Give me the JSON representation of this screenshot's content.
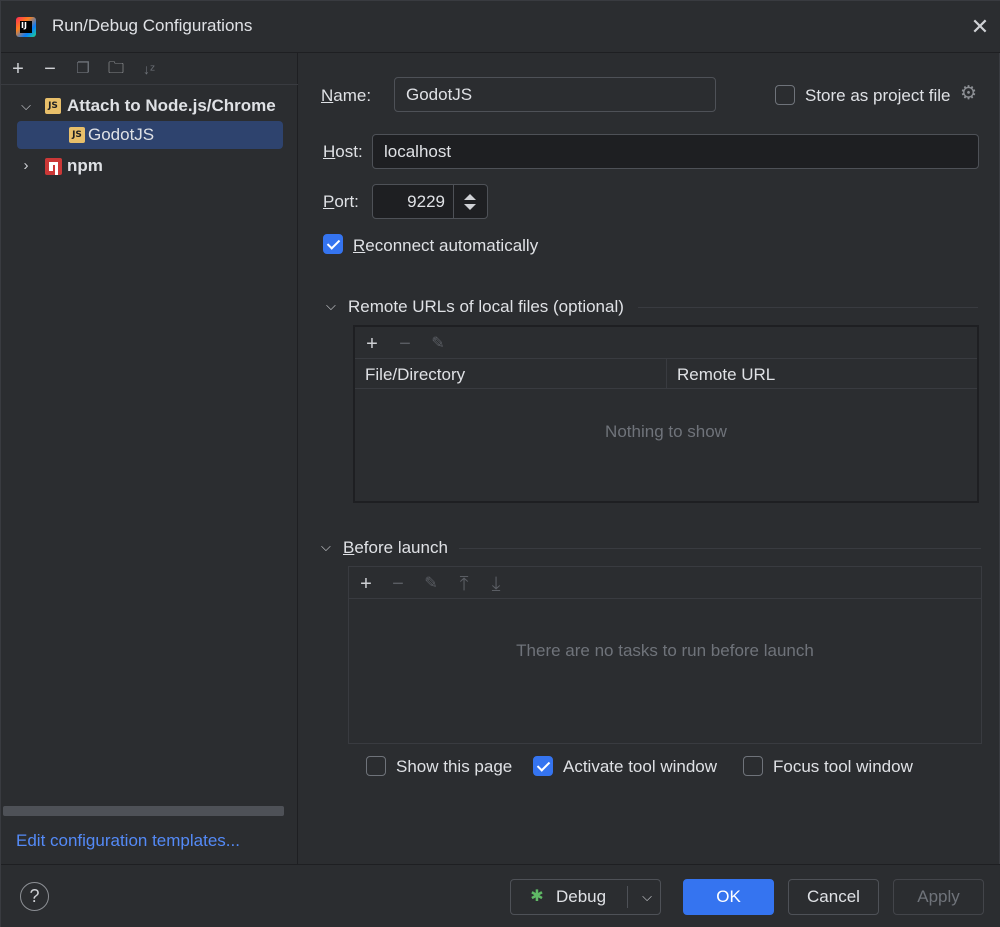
{
  "window": {
    "title": "Run/Debug Configurations"
  },
  "sidebar": {
    "tree": [
      {
        "label": "Attach to Node.js/Chrome",
        "icon": "js-icon",
        "icon_text": "JS",
        "expanded": true
      },
      {
        "label": "GodotJS",
        "icon": "js-icon",
        "icon_text": "JS",
        "selected": true
      },
      {
        "label": "npm",
        "icon": "npm-icon",
        "expanded": false
      }
    ],
    "templates_link": "Edit configuration templates..."
  },
  "form": {
    "name_label": "Name:",
    "name_value": "GodotJS",
    "store_label": "Store as project file",
    "store_checked": false,
    "host_label": "Host:",
    "host_value": "localhost",
    "port_label": "Port:",
    "port_value": "9229",
    "reconnect_label": "Reconnect automatically",
    "reconnect_checked": true
  },
  "remote_urls": {
    "section_title": "Remote URLs of local files (optional)",
    "columns": [
      "File/Directory",
      "Remote URL"
    ],
    "empty_text": "Nothing to show"
  },
  "before_launch": {
    "section_title": "Before launch",
    "empty_text": "There are no tasks to run before launch",
    "options": [
      {
        "label": "Show this page",
        "checked": false
      },
      {
        "label": "Activate tool window",
        "checked": true
      },
      {
        "label": "Focus tool window",
        "checked": false
      }
    ]
  },
  "footer": {
    "help": "?",
    "debug": "Debug",
    "ok": "OK",
    "cancel": "Cancel",
    "apply": "Apply"
  },
  "colors": {
    "accent": "#3574f0",
    "link": "#548af7",
    "selection": "#2e436e",
    "background": "#2b2d30"
  }
}
